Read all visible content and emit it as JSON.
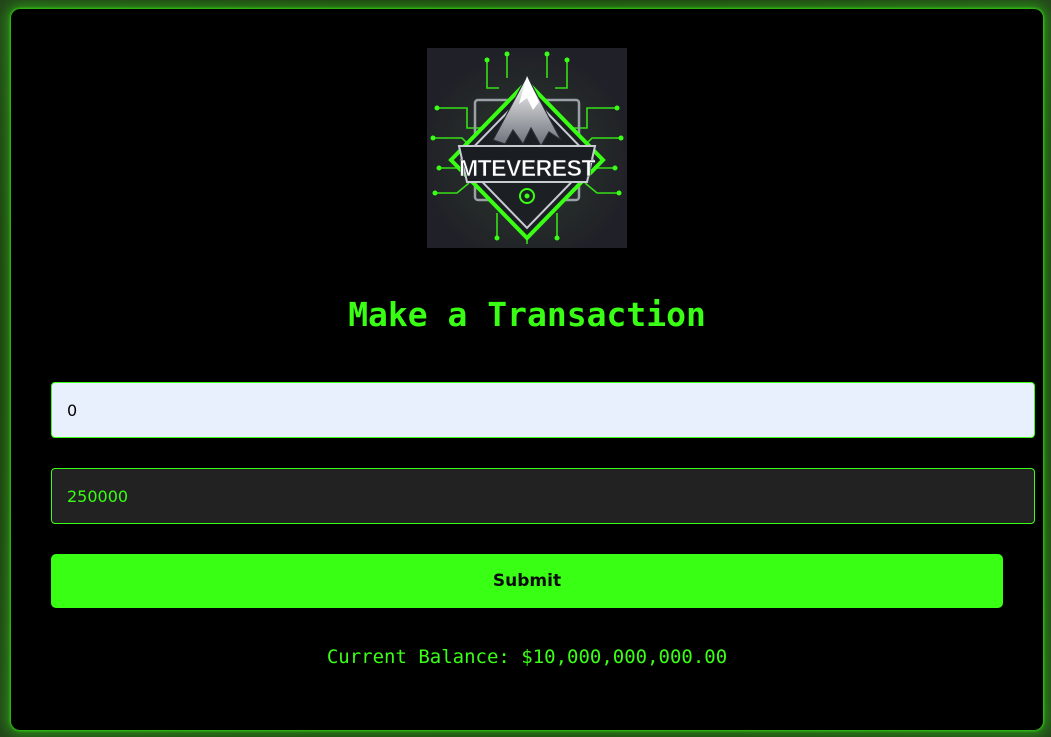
{
  "header": {
    "logo_text": "MTEVEREST",
    "title": "Make a Transaction"
  },
  "form": {
    "recipient_value": "0",
    "amount_value": "250000",
    "submit_label": "Submit"
  },
  "balance": {
    "text": "Current Balance: $10,000,000,000.00"
  },
  "colors": {
    "accent": "#39ff14",
    "background": "#000000",
    "input_light": "#e8f0fe",
    "input_dark": "#222222"
  }
}
